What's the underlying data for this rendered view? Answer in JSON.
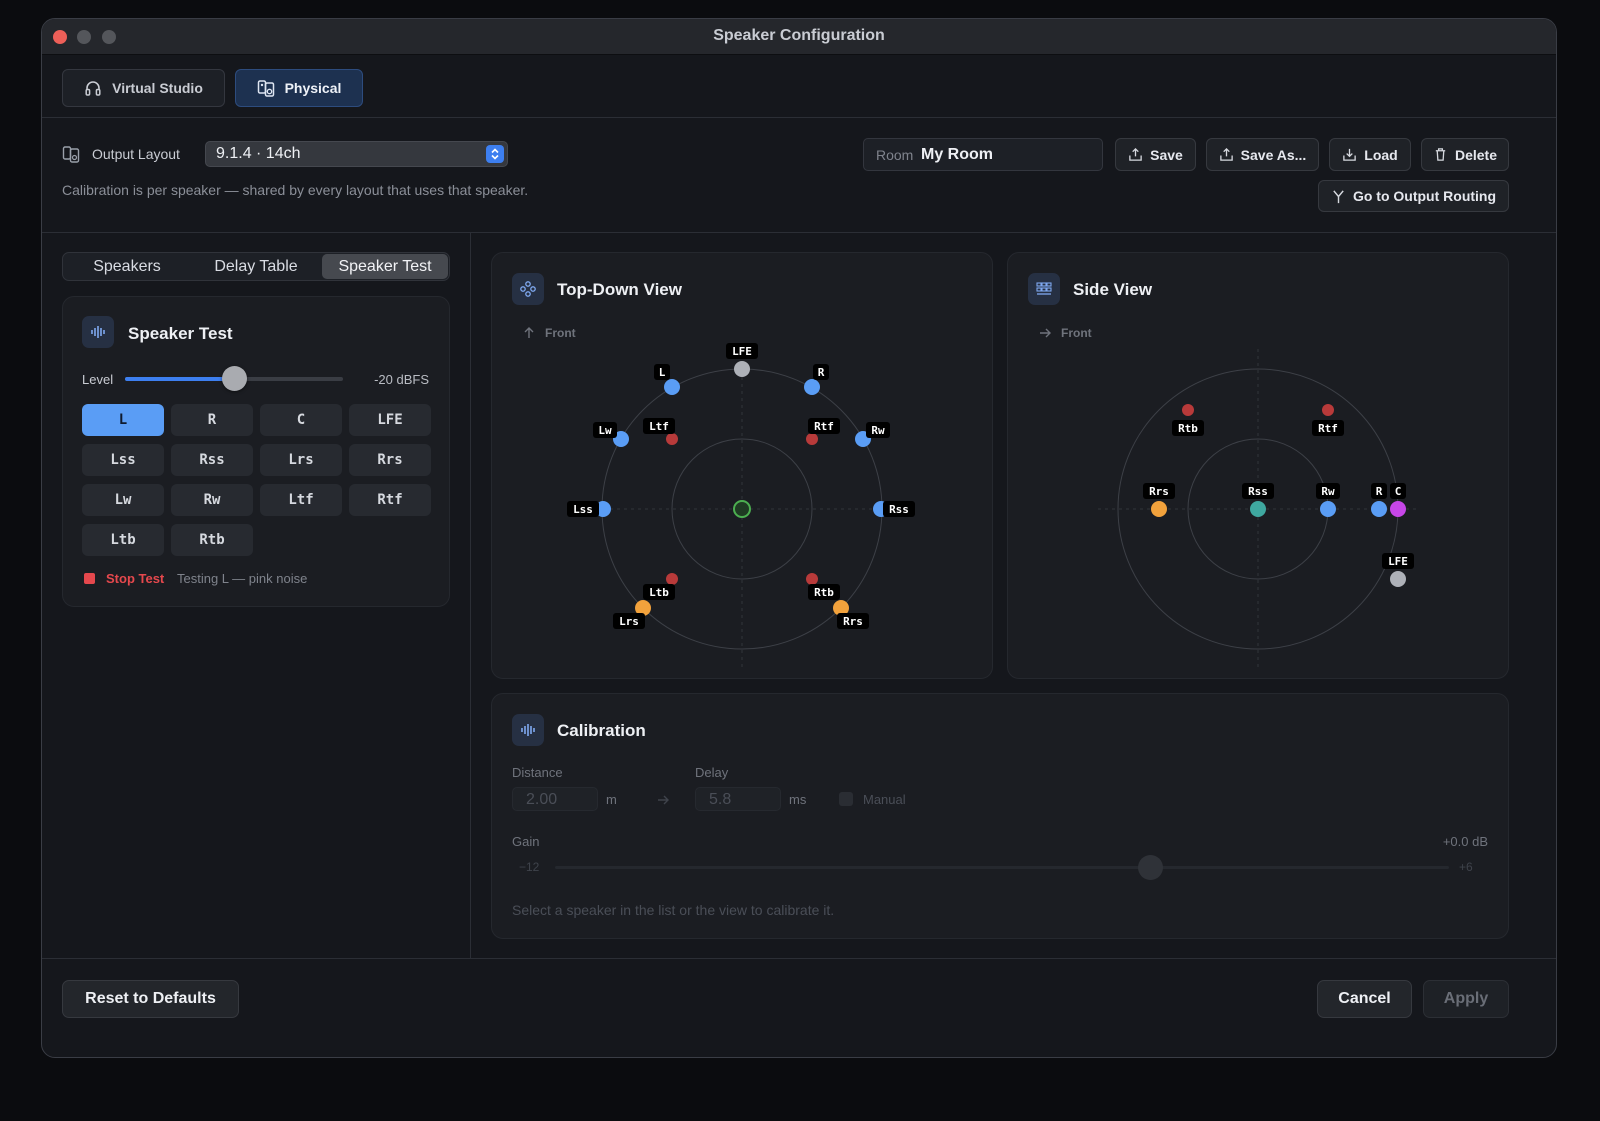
{
  "window": {
    "title": "Speaker Configuration"
  },
  "modes": [
    {
      "label": "Virtual Studio",
      "icon": "headphones-icon",
      "active": false
    },
    {
      "label": "Physical",
      "icon": "speaker-icon",
      "active": true
    }
  ],
  "output": {
    "label": "Output Layout",
    "value": "9.1.4 · 14ch",
    "note": "Calibration is per speaker — shared by every layout that uses that speaker."
  },
  "room": {
    "label": "Room",
    "value": "My Room"
  },
  "toolbar": {
    "save": "Save",
    "save_as": "Save As...",
    "load": "Load",
    "delete": "Delete",
    "routing": "Go to Output Routing"
  },
  "tabs": [
    "Speakers",
    "Delay Table",
    "Speaker Test"
  ],
  "active_tab": "Speaker Test",
  "speaker_test": {
    "title": "Speaker Test",
    "level_label": "Level",
    "level_value": "-20 dBFS",
    "level_fraction": 0.5,
    "speakers": [
      "L",
      "R",
      "C",
      "LFE",
      "Lss",
      "Rss",
      "Lrs",
      "Rrs",
      "Lw",
      "Rw",
      "Ltf",
      "Rtf",
      "Ltb",
      "Rtb"
    ],
    "selected": "L",
    "stop_label": "Stop Test",
    "status": "Testing L — pink noise"
  },
  "top_view": {
    "title": "Top-Down View",
    "front_label": "Front",
    "labels": [
      "LFE",
      "L",
      "R",
      "Lw",
      "Ltf",
      "Rtf",
      "Rw",
      "Lss",
      "Rss",
      "Ltb",
      "Rtb",
      "Lrs",
      "Rrs"
    ]
  },
  "side_view": {
    "title": "Side View",
    "front_label": "Front",
    "labels": [
      "Rtb",
      "Rtf",
      "Rrs",
      "Rss",
      "Rw",
      "R",
      "C",
      "LFE"
    ]
  },
  "calibration": {
    "title": "Calibration",
    "distance_label": "Distance",
    "distance_value": "2.00",
    "distance_unit": "m",
    "delay_label": "Delay",
    "delay_value": "5.8",
    "delay_unit": "ms",
    "manual_label": "Manual",
    "gain_label": "Gain",
    "gain_value": "+0.0 dB",
    "gain_min": "−12",
    "gain_max": "+6",
    "hint": "Select a speaker in the list or the view to calibrate it."
  },
  "footer": {
    "reset": "Reset to Defaults",
    "cancel": "Cancel",
    "apply": "Apply"
  },
  "colors": {
    "accent": "#5a9df5",
    "danger": "#e5484d",
    "orange": "#f2a23c",
    "red_top": "#b83a3a",
    "listener": "#4caf50",
    "magenta": "#c746e8",
    "teal": "#3fa8a0",
    "grey": "#aeb1b8"
  }
}
